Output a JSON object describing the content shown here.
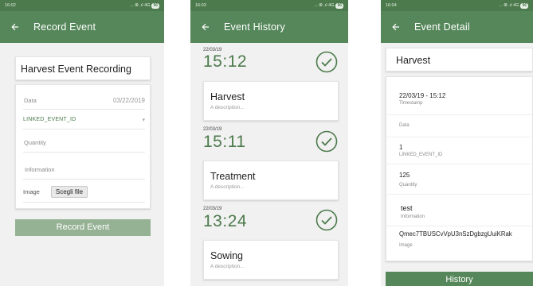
{
  "record": {
    "status_time": "16:02",
    "status_right": "... ⦾ .ıl 4G",
    "battery": "96",
    "title": "Record Event",
    "event_title": "Harvest Event Recording",
    "data_label": "Data",
    "data_value": "03/22/2019",
    "linked_label": "LINKED_EVENT_ID",
    "quantity_placeholder": "Quantity",
    "information_placeholder": "Information",
    "image_label": "Image",
    "file_button": "Scegli file",
    "submit_label": "Record Event"
  },
  "history": {
    "status_time": "16:03",
    "status_right": "... ⦾ .ıl 4G",
    "battery": "96",
    "title": "Event History",
    "events": [
      {
        "date": "22/03/19",
        "time": "15:12",
        "name": "Harvest",
        "description": "A description..."
      },
      {
        "date": "22/03/19",
        "time": "15:11",
        "name": "Treatment",
        "description": "A description..."
      },
      {
        "date": "22/03/19",
        "time": "13:24",
        "name": "Sowing",
        "description": "A description..."
      }
    ]
  },
  "detail": {
    "status_time": "16:04",
    "status_right": "... ⦾ .ıl 4G",
    "battery": "96",
    "title": "Event Detail",
    "event_name": "Harvest",
    "fields": [
      {
        "value": "22/03/19 - 15:12",
        "label": "Timestamp"
      },
      {
        "value": "",
        "label": "Data"
      },
      {
        "value": "1",
        "label": "LINKED_EVENT_ID"
      },
      {
        "value": "125",
        "label": "Quantity"
      },
      {
        "value": "test",
        "label": "Information"
      },
      {
        "value": "Qmec7TBUSCvVpU3nSzDgbzgUuiKRak",
        "label": "Image"
      }
    ],
    "history_button": "History"
  },
  "colors": {
    "primary": "#55875a",
    "statusbar": "#4c7a4c",
    "accent_text": "#4c7a4c",
    "button_disabled": "#96b294"
  }
}
